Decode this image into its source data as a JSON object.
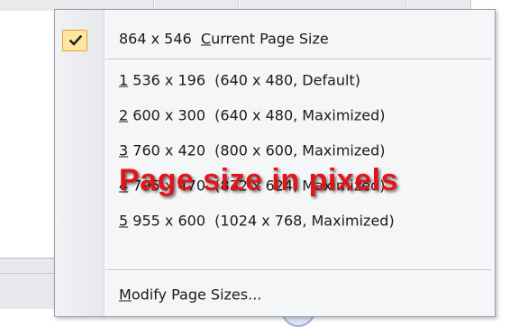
{
  "menu": {
    "current": {
      "size": "864 x 546",
      "label_accel": "C",
      "label_rest": "urrent Page Size",
      "checked": true
    },
    "presets": [
      {
        "num": "1",
        "size": "536 x 196",
        "desc": "(640 x 480, Default)"
      },
      {
        "num": "2",
        "size": "600 x 300",
        "desc": "(640 x 480, Maximized)"
      },
      {
        "num": "3",
        "size": "760 x 420",
        "desc": "(800 x 600, Maximized)"
      },
      {
        "num": "4",
        "size": "795 x 470",
        "desc": "(832 x 624, Maximized)"
      },
      {
        "num": "5",
        "size": "955 x 600",
        "desc": "(1024 x 768, Maximized)"
      }
    ],
    "modify": {
      "accel": "M",
      "rest": "odify Page Sizes..."
    }
  },
  "annotation": {
    "text": "Page size in pixels",
    "color": "#e0161b"
  },
  "colors": {
    "check_bg": "#fde7a3",
    "check_border": "#e5a233"
  },
  "icons": {
    "check": "check-icon"
  }
}
